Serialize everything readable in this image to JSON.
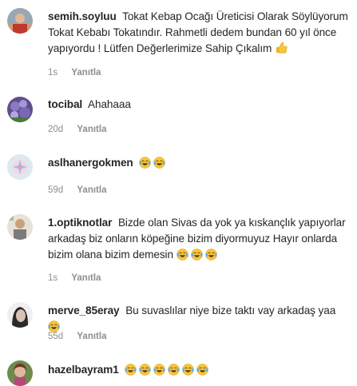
{
  "comments": [
    {
      "username": "semih.soyluu",
      "text": "Tokat Kebap Ocağı Üreticisi Olarak Söylüyorum Tokat Kebabı Tokatındır. Rahmetli dedem bundan 60 yıl önce yapıyordu ! Lütfen Değerlerimize Sahip Çıkalım",
      "emoji": "👍",
      "time": "1s",
      "reply_label": "Yanıtla"
    },
    {
      "username": "tocibal",
      "text": "Ahahaaa",
      "time": "20d",
      "reply_label": "Yanıtla"
    },
    {
      "username": "aslhanergokmen",
      "emoji": "😂😂",
      "time": "59d",
      "reply_label": "Yanıtla"
    },
    {
      "username": "1.optiknotlar",
      "text": "Bizde olan Sivas da yok ya kıskançlık yapıyorlar arkadaş biz onların köpeğine bizim diyormuyuz Hayır onlarda bizim olana bizim demesin",
      "emoji": "😂😂😂",
      "time": "1s",
      "reply_label": "Yanıtla"
    },
    {
      "username": "merve_85eray",
      "text": "Bu suvaslılar niye bize taktı vay arkadaş yaa",
      "emoji": "😂",
      "time": "55d",
      "reply_label": "Yanıtla"
    },
    {
      "username": "hazelbayram1",
      "emoji": "😂😂😂😂😂😂"
    }
  ],
  "colors": {
    "text": "#262626",
    "meta": "#8e8e8e",
    "emoji_face": "#f7c53b"
  },
  "icons": {
    "thumbs_up": "thumbs-up-icon",
    "laugh": "tears-of-joy-icon"
  }
}
